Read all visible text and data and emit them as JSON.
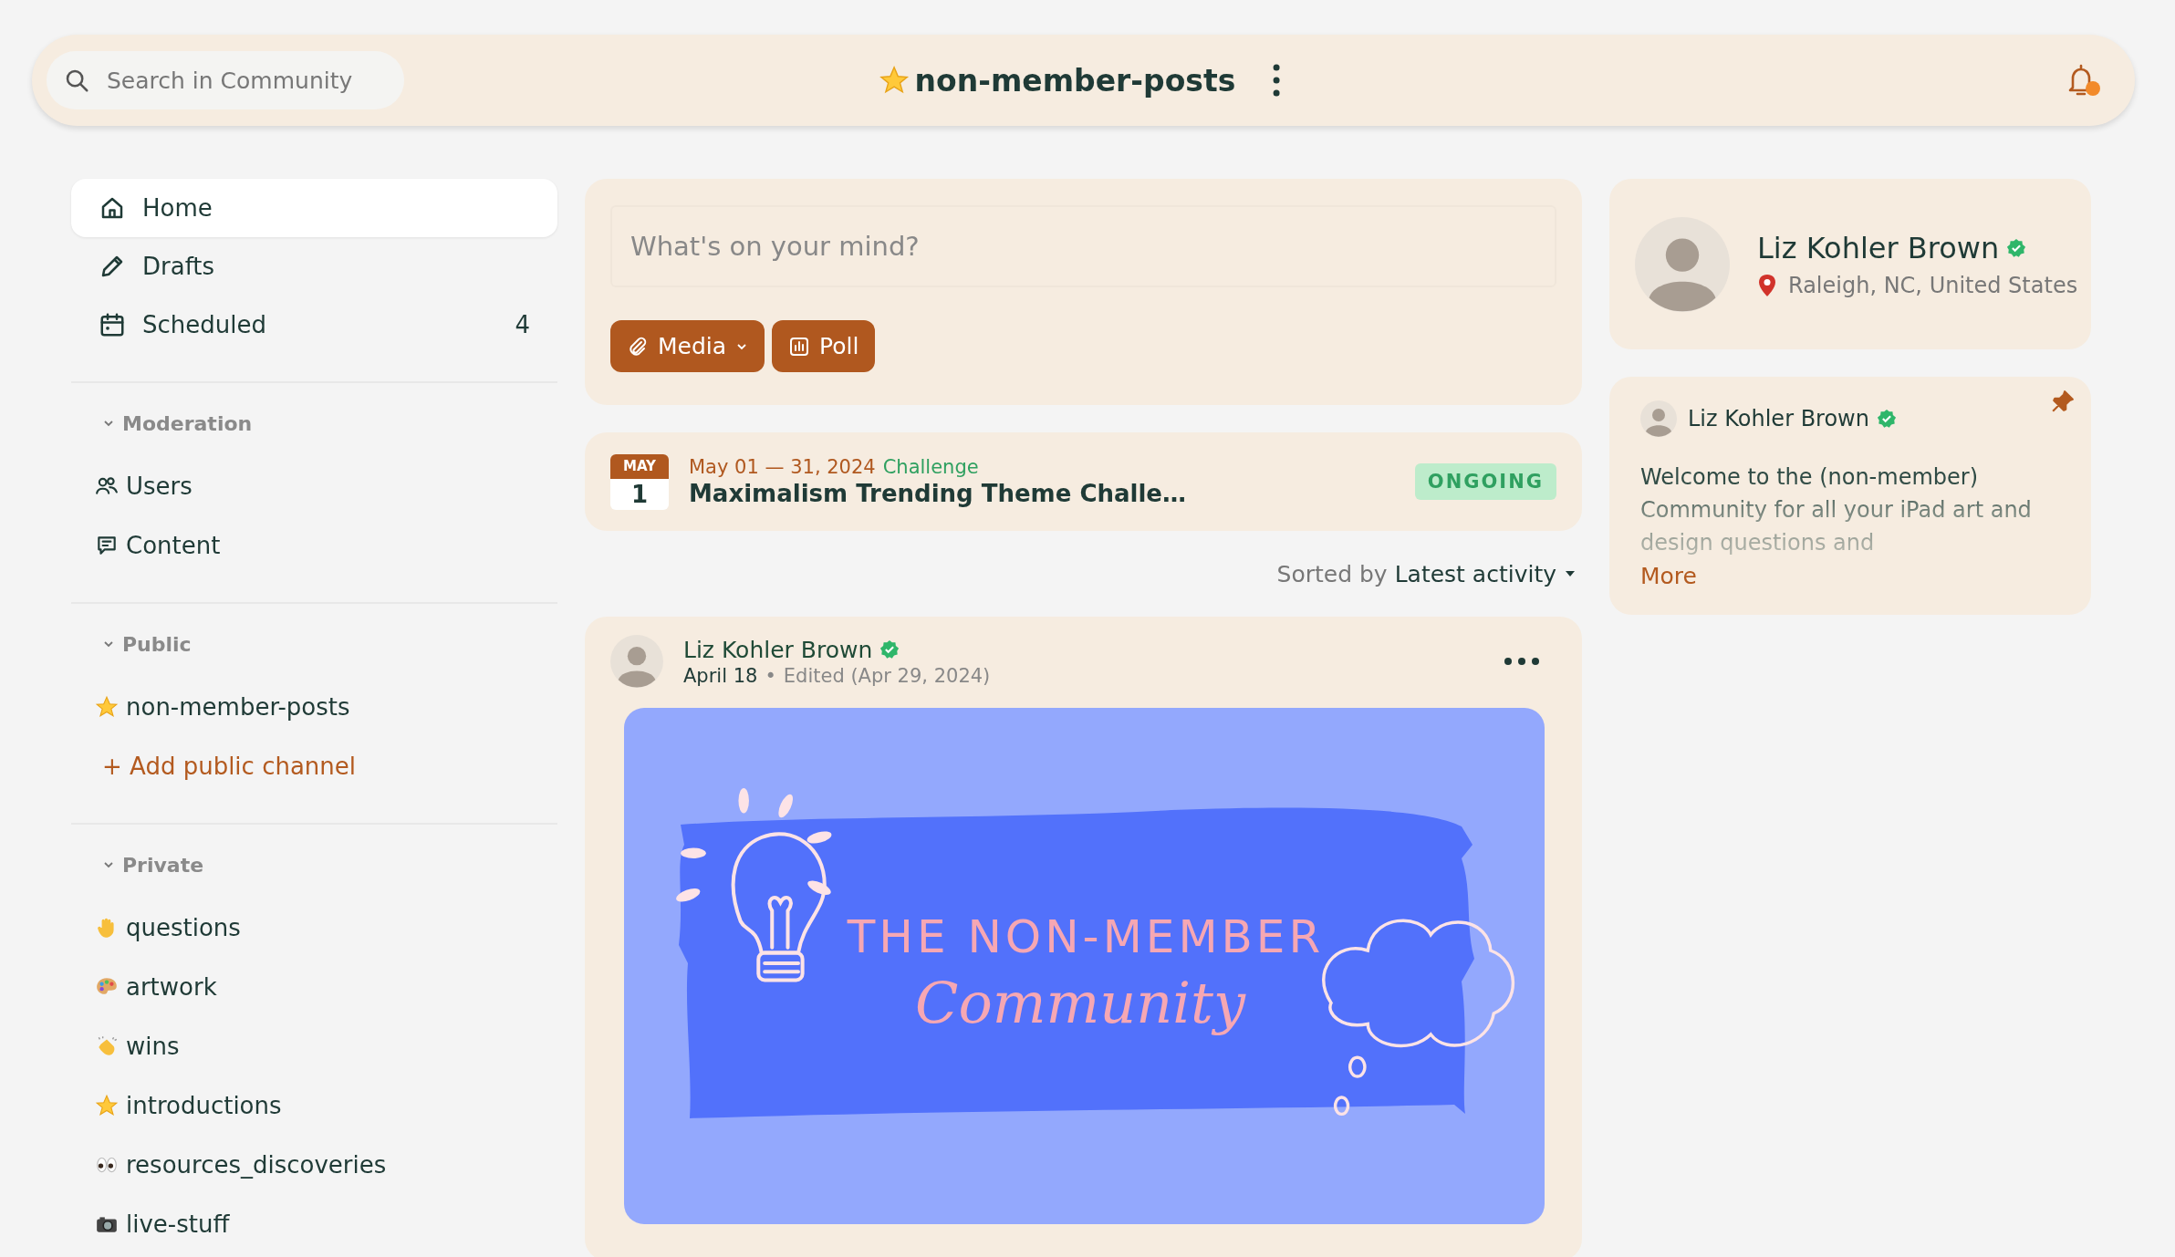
{
  "top_bar": {
    "search": {
      "placeholder": "Search in Community"
    },
    "channel_title": "non-member-posts",
    "notifications": {
      "unread": true
    }
  },
  "sidebar": {
    "nav": [
      {
        "label": "Home",
        "kind": "home",
        "selected": true
      },
      {
        "label": "Drafts",
        "kind": "pencil",
        "selected": false
      },
      {
        "label": "Scheduled",
        "kind": "calendar",
        "count": "4",
        "selected": false
      }
    ],
    "sections": [
      {
        "title": "Moderation",
        "expanded": true,
        "items": [
          {
            "label": "Users",
            "kind": "users",
            "selected": false
          },
          {
            "label": "Content",
            "kind": "chat",
            "selected": false
          }
        ]
      },
      {
        "title": "Public",
        "expanded": true,
        "items": [
          {
            "label": "non-member-posts",
            "kind": "star",
            "selected": false
          }
        ],
        "add_link": "+ Add public channel"
      },
      {
        "title": "Private",
        "expanded": true,
        "items": [
          {
            "label": "questions",
            "kind": "hand",
            "selected": false
          },
          {
            "label": "artwork",
            "kind": "palette",
            "selected": false
          },
          {
            "label": "wins",
            "kind": "clap",
            "selected": false
          },
          {
            "label": "introductions",
            "kind": "star",
            "selected": false
          },
          {
            "label": "resources_discoveries",
            "kind": "eyes",
            "selected": false
          },
          {
            "label": "live-stuff",
            "kind": "camera",
            "selected": false
          }
        ]
      }
    ]
  },
  "composer": {
    "placeholder": "What's on your mind?",
    "buttons": [
      {
        "label": "Media",
        "kind": "media"
      },
      {
        "label": "Poll",
        "kind": "poll"
      }
    ]
  },
  "event": {
    "month": "MAY",
    "day": "1",
    "dates": "May 01 — 31, 2024",
    "type": "Challenge",
    "title": "Maximalism Trending Theme Challe…",
    "status": "ONGOING"
  },
  "sort": {
    "label": "Sorted by",
    "value": "Latest activity"
  },
  "post": {
    "author": "Liz Kohler Brown",
    "verified": true,
    "date": "April 18",
    "separator": "•",
    "edited": "Edited (Apr 29, 2024)",
    "image": {
      "title": "THE NON-MEMBER",
      "script": "Community"
    }
  },
  "profile": {
    "name": "Liz Kohler Brown",
    "verified": true,
    "location": "Raleigh, NC, United States"
  },
  "pinned_post": {
    "author": "Liz Kohler Brown",
    "verified": true,
    "pinned": true,
    "text": "Welcome to the (non-member) Community for all your iPad art and design questions and",
    "more": "More"
  }
}
